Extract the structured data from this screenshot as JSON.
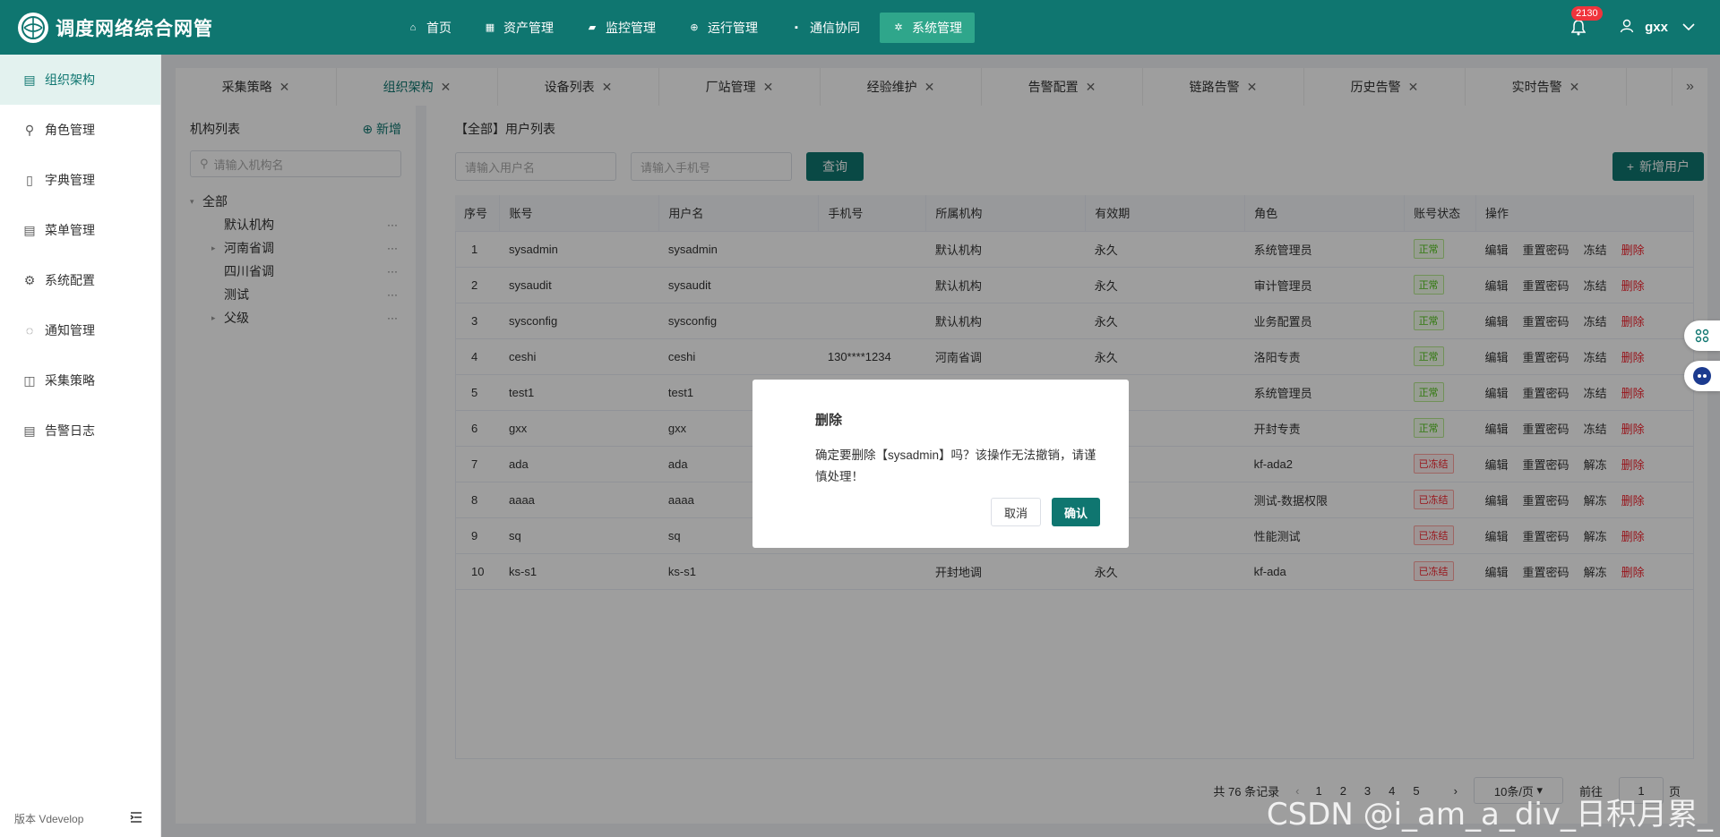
{
  "brand": {
    "title": "调度网络综合网管"
  },
  "nav": [
    {
      "label": "首页",
      "icon": "home-icon",
      "glyph": "⌂"
    },
    {
      "label": "资产管理",
      "icon": "grid-icon",
      "glyph": "▦"
    },
    {
      "label": "监控管理",
      "icon": "car-icon",
      "glyph": "▰"
    },
    {
      "label": "运行管理",
      "icon": "plus-circle-icon",
      "glyph": "⊕"
    },
    {
      "label": "通信协同",
      "icon": "message-icon",
      "glyph": "▪"
    },
    {
      "label": "系统管理",
      "icon": "gear-icon",
      "glyph": "✲"
    }
  ],
  "header": {
    "badge": "2130",
    "user": "gxx"
  },
  "sidebar": {
    "items": [
      {
        "label": "组织架构",
        "glyph": "▤"
      },
      {
        "label": "角色管理",
        "glyph": "⚲"
      },
      {
        "label": "字典管理",
        "glyph": "▯"
      },
      {
        "label": "菜单管理",
        "glyph": "▤"
      },
      {
        "label": "系统配置",
        "glyph": "⚙"
      },
      {
        "label": "通知管理",
        "glyph": "◌"
      },
      {
        "label": "采集策略",
        "glyph": "◫"
      },
      {
        "label": "告警日志",
        "glyph": "▤"
      }
    ],
    "version": "版本 Vdevelop"
  },
  "tabs": [
    "采集策略",
    "组织架构",
    "设备列表",
    "厂站管理",
    "经验维护",
    "告警配置",
    "链路告警",
    "历史告警",
    "实时告警"
  ],
  "org": {
    "title": "机构列表",
    "add": "新增",
    "search_placeholder": "请输入机构名",
    "tree": [
      {
        "label": "全部",
        "level": 0,
        "arrow": "▾",
        "more": ""
      },
      {
        "label": "默认机构",
        "level": 1,
        "arrow": "",
        "more": "···"
      },
      {
        "label": "河南省调",
        "level": 1,
        "arrow": "▸",
        "more": "···"
      },
      {
        "label": "四川省调",
        "level": 1,
        "arrow": "",
        "more": "···"
      },
      {
        "label": "测试",
        "level": 1,
        "arrow": "",
        "more": "···"
      },
      {
        "label": "父级",
        "level": 1,
        "arrow": "▸",
        "more": "···"
      }
    ]
  },
  "users": {
    "title": "【全部】用户列表",
    "username_placeholder": "请输入用户名",
    "phone_placeholder": "请输入手机号",
    "query": "查询",
    "add_user": "新增用户",
    "columns": [
      "序号",
      "账号",
      "用户名",
      "手机号",
      "所属机构",
      "有效期",
      "角色",
      "账号状态",
      "操作"
    ],
    "rows": [
      [
        "1",
        "sysadmin",
        "sysadmin",
        "",
        "默认机构",
        "永久",
        "系统管理员",
        "正常",
        "冻结"
      ],
      [
        "2",
        "sysaudit",
        "sysaudit",
        "",
        "默认机构",
        "永久",
        "审计管理员",
        "正常",
        "冻结"
      ],
      [
        "3",
        "sysconfig",
        "sysconfig",
        "",
        "默认机构",
        "永久",
        "业务配置员",
        "正常",
        "冻结"
      ],
      [
        "4",
        "ceshi",
        "ceshi",
        "130****1234",
        "河南省调",
        "永久",
        "洛阳专责",
        "正常",
        "冻结"
      ],
      [
        "5",
        "test1",
        "test1",
        "",
        "",
        "",
        "系统管理员",
        "正常",
        "冻结"
      ],
      [
        "6",
        "gxx",
        "gxx",
        "",
        "",
        "",
        "开封专责",
        "正常",
        "冻结"
      ],
      [
        "7",
        "ada",
        "ada",
        "",
        "",
        "",
        "kf-ada2",
        "已冻结",
        "解冻"
      ],
      [
        "8",
        "aaaa",
        "aaaa",
        "",
        "",
        "",
        "测试-数据权限",
        "已冻结",
        "解冻"
      ],
      [
        "9",
        "sq",
        "sq",
        "",
        "",
        "",
        "性能测试",
        "已冻结",
        "解冻"
      ],
      [
        "10",
        "ks-s1",
        "ks-s1",
        "",
        "开封地调",
        "永久",
        "kf-ada",
        "已冻结",
        "解冻"
      ]
    ],
    "op_edit": "编辑",
    "op_reset": "重置密码",
    "op_delete": "删除",
    "total": "共 76 条记录",
    "pages": [
      "1",
      "2",
      "3",
      "4",
      "5"
    ],
    "page_size": "10条/页",
    "goto": "前往",
    "goto_value": "1",
    "page_unit": "页"
  },
  "dialog": {
    "title": "删除",
    "message": "确定要删除【sysadmin】吗？该操作无法撤销，请谨慎处理！",
    "cancel": "取消",
    "confirm": "确认"
  },
  "watermark": "CSDN @i_am_a_div_日积月累_",
  "colors": {
    "primary": "#0f7670",
    "danger": "#f5222d",
    "success": "#52c41a"
  }
}
